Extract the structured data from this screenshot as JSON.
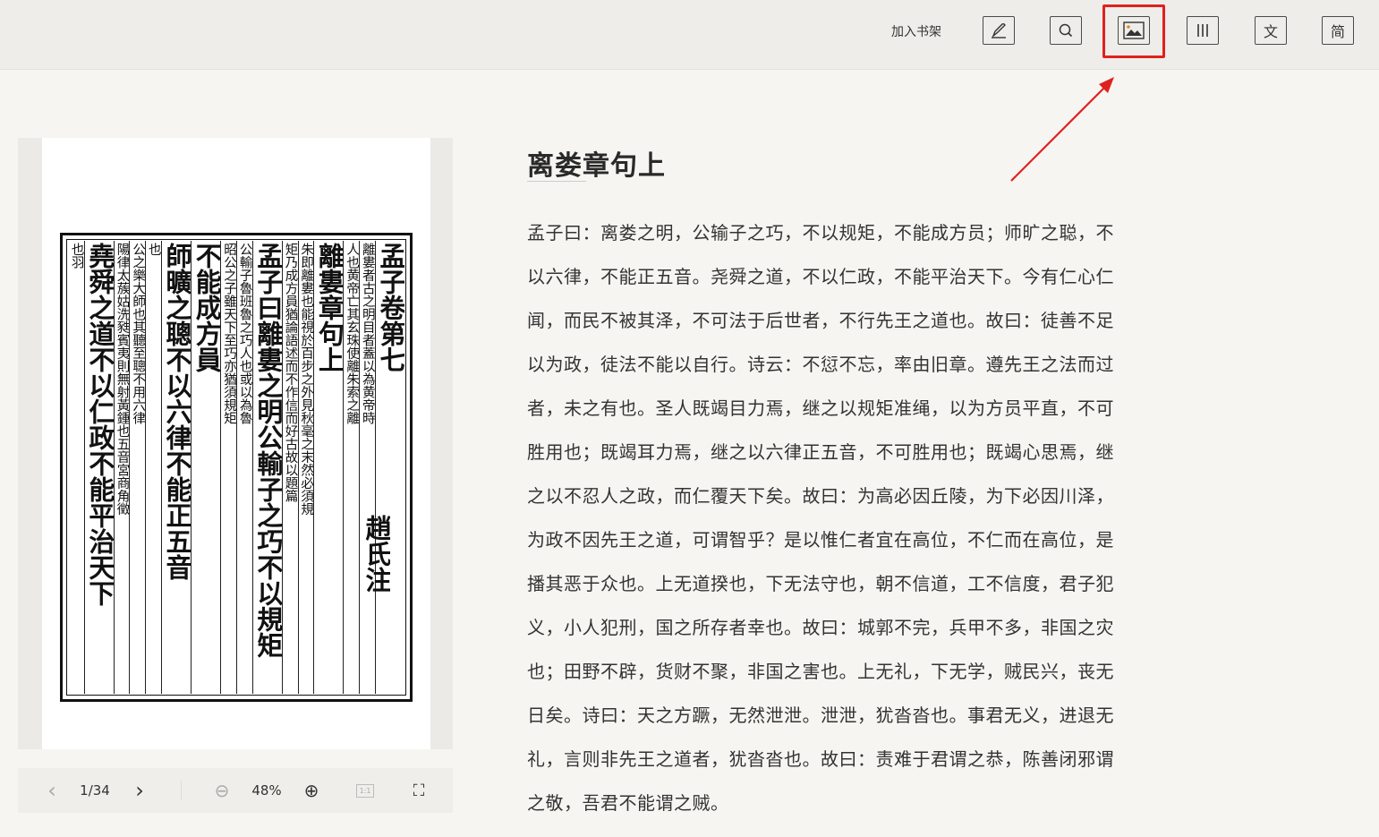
{
  "toolbar": {
    "add_to_shelf": "加入书架",
    "tools": [
      {
        "name": "annotate-icon",
        "glyph": ""
      },
      {
        "name": "search-icon",
        "glyph": ""
      },
      {
        "name": "image-view-icon",
        "glyph": ""
      },
      {
        "name": "columns-icon",
        "glyph": ""
      },
      {
        "name": "text-mode",
        "glyph": "文"
      },
      {
        "name": "simplified-mode",
        "glyph": "简"
      }
    ],
    "highlight_color": "#e0211d"
  },
  "scan": {
    "columns": [
      {
        "size": "big",
        "text": "孟子卷第七"
      },
      {
        "size": "small",
        "text": "離婁者古之明目者蓋以為黄帝時"
      },
      {
        "size": "small",
        "text": "人也黄帝亡其玄珠使離朱索之離"
      },
      {
        "size": "big",
        "text": "離婁章句上"
      },
      {
        "size": "small",
        "text": "朱即離婁也能視於百步之外見秋毫之末然必須規"
      },
      {
        "size": "small",
        "text": "矩乃成方員猶論語述而不作信而好古故以題篇"
      },
      {
        "size": "big",
        "text": "孟子曰離婁之明公輸子之巧不以規矩"
      },
      {
        "size": "small",
        "text": "公輸子魯班魯之巧人也或以為魯"
      },
      {
        "size": "small",
        "text": "昭公之子雖天下至巧亦猶須規矩"
      },
      {
        "size": "big",
        "text": "不能成方員"
      },
      {
        "size": "big",
        "text": "師曠之聰不以六律不能正五音"
      },
      {
        "size": "small",
        "text": "也"
      },
      {
        "size": "small",
        "text": "公之樂大師也其聽至聰不用六律"
      },
      {
        "size": "small",
        "text": "陽律太蔟姑洗甤賓夷則無射黃鍾也五音宮商角徵"
      },
      {
        "size": "big",
        "text": "堯舜之道不以仁政不能平治天下"
      },
      {
        "size": "small",
        "text": "也羽"
      }
    ],
    "author": "趙氏注",
    "viewer": {
      "prev_icon": "‹",
      "page": "1/34",
      "next_icon": "›",
      "zoom_out_icon": "⊖",
      "zoom": "48%",
      "zoom_in_icon": "⊕",
      "actual_size": "1:1",
      "fullscreen_icon": "⛶"
    }
  },
  "chapter": {
    "title": "离娄章句上",
    "lines": [
      "孟子曰：离娄之明，公输子之巧，不以规矩，不能成方员；师旷之聪，不",
      "以六律，不能正五音。尧舜之道，不以仁政，不能平治天下。今有仁心仁",
      "闻，而民不被其泽，不可法于后世者，不行先王之道也。故曰：徒善不足",
      "以为政，徒法不能以自行。诗云：不愆不忘，率由旧章。遵先王之法而过",
      "者，未之有也。圣人既竭目力焉，继之以规矩准绳，以为方员平直，不可",
      "胜用也；既竭耳力焉，继之以六律正五音，不可胜用也；既竭心思焉，继",
      "之以不忍人之政，而仁覆天下矣。故曰：为高必因丘陵，为下必因川泽，",
      "为政不因先王之道，可谓智乎？是以惟仁者宜在高位，不仁而在高位，是",
      "播其恶于众也。上无道揆也，下无法守也，朝不信道，工不信度，君子犯",
      "义，小人犯刑，国之所存者幸也。故曰：城郭不完，兵甲不多，非国之灾",
      "也；田野不辟，货财不聚，非国之害也。上无礼，下无学，贼民兴，丧无",
      "日矣。诗曰：天之方蹶，无然泄泄。泄泄，犹沓沓也。事君无义，进退无",
      "礼，言则非先王之道者，犹沓沓也。故曰：责难于君谓之恭，陈善闭邪谓",
      "之敬，吾君不能谓之贼。"
    ]
  }
}
